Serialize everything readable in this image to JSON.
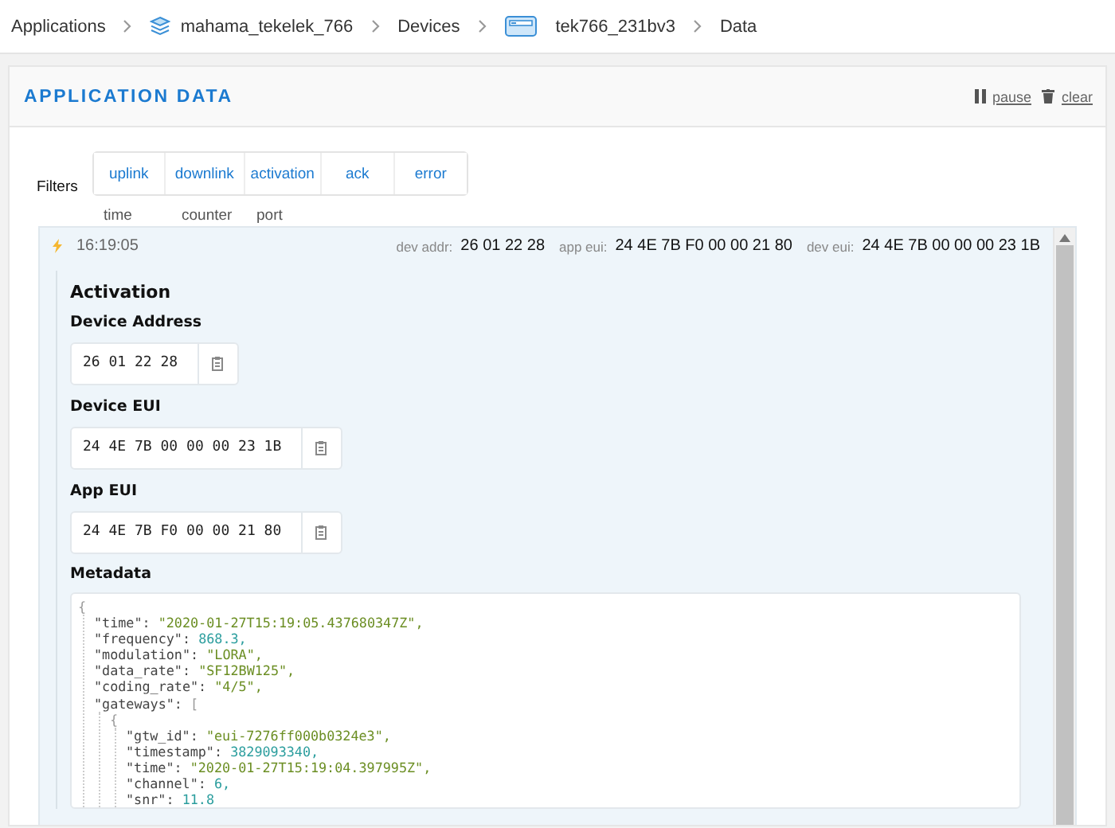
{
  "breadcrumb": [
    {
      "label": "Applications",
      "kind": "link"
    },
    {
      "label": "mahama_tekelek_766",
      "kind": "application"
    },
    {
      "label": "Devices",
      "kind": "link"
    },
    {
      "label": "tek766_231bv3",
      "kind": "device"
    },
    {
      "label": "Data",
      "kind": "current"
    }
  ],
  "card": {
    "title": "APPLICATION DATA",
    "actions": [
      {
        "label": "pause",
        "kind": "pause"
      },
      {
        "label": "clear",
        "kind": "clear"
      }
    ]
  },
  "filters": {
    "label": "Filters",
    "items": [
      {
        "label": "uplink",
        "selected": false
      },
      {
        "label": "downlink",
        "selected": false
      },
      {
        "label": "activation",
        "selected": false
      },
      {
        "label": "ack",
        "selected": false
      },
      {
        "label": "error",
        "selected": false
      }
    ]
  },
  "columns": [
    "time",
    "counter",
    "port"
  ],
  "event": {
    "kind": "activation",
    "time": "16:19:05",
    "fields": [
      {
        "label": "dev addr:",
        "value": "26 01 22 28"
      },
      {
        "label": "app eui:",
        "value": "24 4E 7B F0 00 00 21 80"
      },
      {
        "label": "dev eui:",
        "value": "24 4E 7B 00 00 00 23 1B"
      }
    ],
    "title": "Activation",
    "details": [
      {
        "label": "Device Address",
        "value": "26 01 22 28"
      },
      {
        "label": "Device EUI",
        "value": "24 4E 7B 00 00 00 23 1B"
      },
      {
        "label": "App EUI",
        "value": "24 4E 7B F0 00 00 21 80"
      }
    ],
    "metadata_label": "Metadata",
    "metadata": [
      {
        "value": "{",
        "kind": "punct",
        "children": [
          {
            "key": "\"time\":",
            "value": "\"2020-01-27T15:19:05.437680347Z\",",
            "kind": "string"
          },
          {
            "key": "\"frequency\":",
            "value": "868.3,",
            "kind": "number"
          },
          {
            "key": "\"modulation\":",
            "value": "\"LORA\",",
            "kind": "string"
          },
          {
            "key": "\"data_rate\":",
            "value": "\"SF12BW125\",",
            "kind": "string"
          },
          {
            "key": "\"coding_rate\":",
            "value": "\"4/5\",",
            "kind": "string"
          },
          {
            "key": "\"gateways\":",
            "value": "[",
            "kind": "punct",
            "children": [
              {
                "value": "{",
                "kind": "punct",
                "children": [
                  {
                    "key": "\"gtw_id\":",
                    "value": "\"eui-7276ff000b0324e3\",",
                    "kind": "string"
                  },
                  {
                    "key": "\"timestamp\":",
                    "value": "3829093340,",
                    "kind": "number"
                  },
                  {
                    "key": "\"time\":",
                    "value": "\"2020-01-27T15:19:04.397995Z\",",
                    "kind": "string"
                  },
                  {
                    "key": "\"channel\":",
                    "value": "6,",
                    "kind": "number"
                  },
                  {
                    "key": "\"snr\":",
                    "value": "11.8",
                    "kind": "number"
                  }
                ]
              }
            ]
          }
        ]
      }
    ]
  }
}
